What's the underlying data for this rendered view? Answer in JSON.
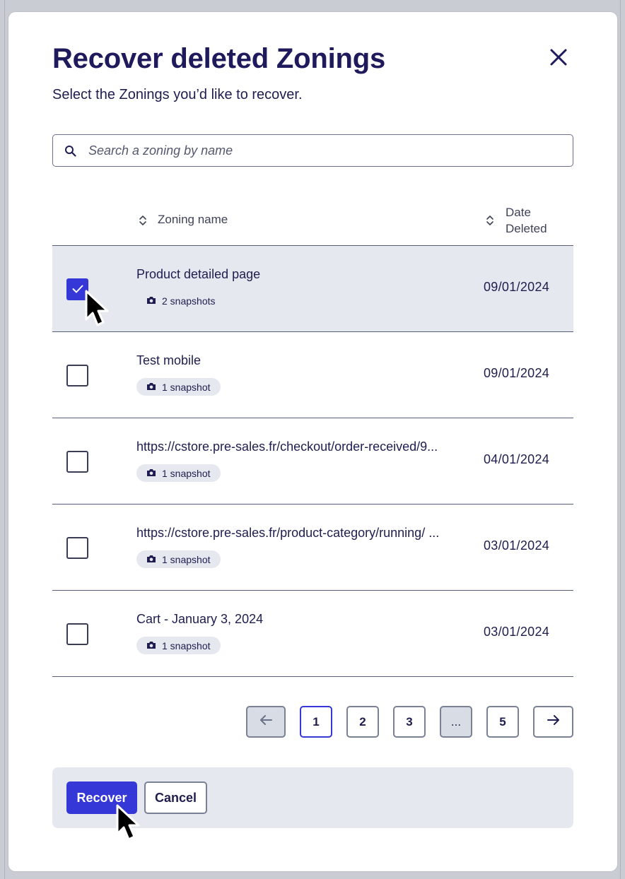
{
  "modal": {
    "title": "Recover deleted Zonings",
    "subtitle": "Select the Zonings you’d like to recover.",
    "close_icon": "close-icon"
  },
  "search": {
    "placeholder": "Search a zoning by name",
    "icon": "search-icon"
  },
  "table": {
    "columns": [
      {
        "label": "Zoning name",
        "icon": "sort-icon"
      },
      {
        "label": "Date\nDeleted",
        "line1": "Date",
        "line2": "Deleted",
        "icon": "sort-icon"
      }
    ],
    "rows": [
      {
        "name": "Product detailed page",
        "snapshots": "2 snapshots",
        "date": "09/01/2024",
        "checked": true
      },
      {
        "name": "Test mobile",
        "snapshots": "1 snapshot",
        "date": "09/01/2024",
        "checked": false
      },
      {
        "name": "https://cstore.pre-sales.fr/checkout/order-received/9...",
        "snapshots": "1 snapshot",
        "date": "04/01/2024",
        "checked": false
      },
      {
        "name": "https://cstore.pre-sales.fr/product-category/running/ ...",
        "snapshots": "1 snapshot",
        "date": "03/01/2024",
        "checked": false
      },
      {
        "name": "Cart - January 3, 2024",
        "snapshots": "1 snapshot",
        "date": "03/01/2024",
        "checked": false
      }
    ]
  },
  "pagination": {
    "prev_icon": "arrow-left-icon",
    "next_icon": "arrow-right-icon",
    "pages": [
      "1",
      "2",
      "3",
      "...",
      "5"
    ],
    "current": "1"
  },
  "footer": {
    "recover_label": "Recover",
    "cancel_label": "Cancel"
  },
  "colors": {
    "primary": "#3537d6",
    "title": "#1f1a5c",
    "selected_row": "#e5e8ee"
  }
}
